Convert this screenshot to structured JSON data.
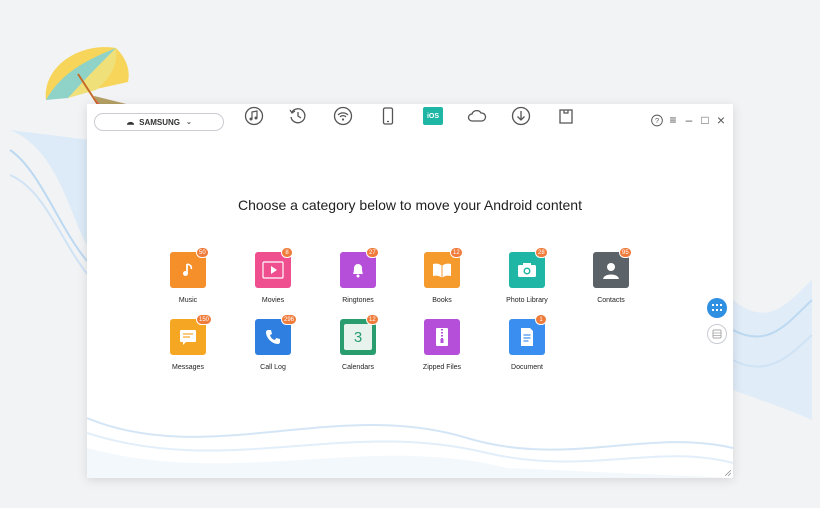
{
  "device": {
    "name": "SAMSUNG"
  },
  "toolbar": {
    "items": [
      {
        "icon": "music-note-icon"
      },
      {
        "icon": "history-icon"
      },
      {
        "icon": "wifi-transfer-icon"
      },
      {
        "icon": "phone-icon"
      },
      {
        "icon": "ios-icon",
        "label": "iOS",
        "active": true
      },
      {
        "icon": "cloud-icon"
      },
      {
        "icon": "download-icon"
      },
      {
        "icon": "toolbox-icon"
      }
    ]
  },
  "window_controls": {
    "help": "?",
    "menu": "≡",
    "minimize": "–",
    "maximize": "□",
    "close": "×"
  },
  "headline": "Choose a category below to move your Android content",
  "categories": [
    {
      "label": "Music",
      "count": "50",
      "color": "#f58f2a"
    },
    {
      "label": "Movies",
      "count": "8",
      "color": "#ef4f8f"
    },
    {
      "label": "Ringtones",
      "count": "27",
      "color": "#b54fd9"
    },
    {
      "label": "Books",
      "count": "12",
      "color": "#f59a2c"
    },
    {
      "label": "Photo Library",
      "count": "28",
      "color": "#1fb6a6"
    },
    {
      "label": "Contacts",
      "count": "95",
      "color": "#5b6268"
    },
    {
      "label": "Messages",
      "count": "150",
      "color": "#f5a623"
    },
    {
      "label": "Call Log",
      "count": "296",
      "color": "#2f7fe0"
    },
    {
      "label": "Calendars",
      "count": "12",
      "color": "#2a9d6f"
    },
    {
      "label": "Zipped Files",
      "count": "",
      "color": "#b54fd9"
    },
    {
      "label": "Document",
      "count": "1",
      "color": "#3a8ef0"
    }
  ],
  "calendar_day": "3",
  "colors": {
    "accent": "#2f8fe0",
    "badge": "#f07c3c"
  }
}
